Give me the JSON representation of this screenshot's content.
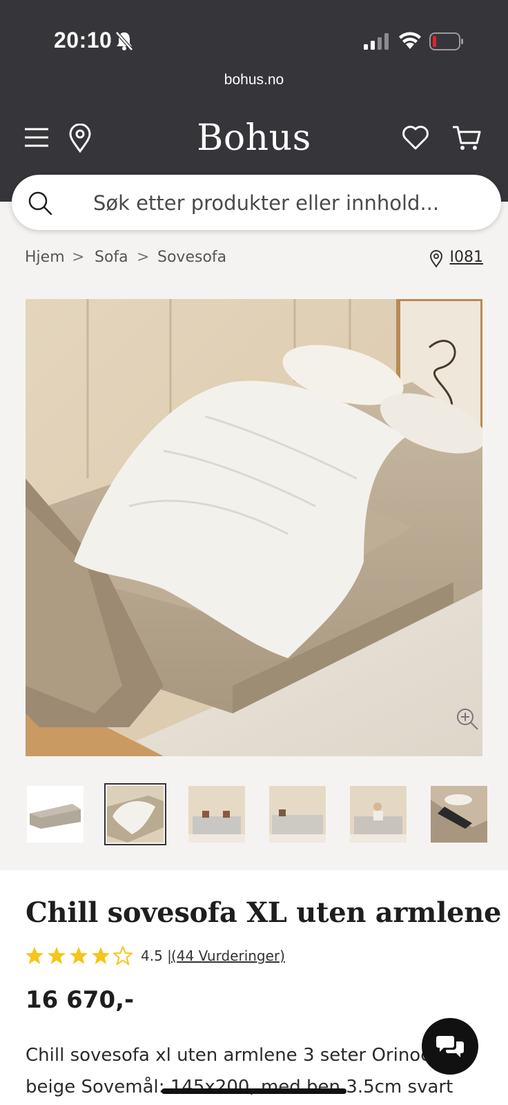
{
  "status_bar": {
    "time": "20:10"
  },
  "browser": {
    "url": "bohus.no"
  },
  "header": {
    "logo": "Bohus"
  },
  "search": {
    "placeholder": "Søk etter produkter eller innhold..."
  },
  "breadcrumb": {
    "items": [
      "Hjem",
      "Sofa",
      "Sovesofa"
    ],
    "separator": ">"
  },
  "store": {
    "label": "I081"
  },
  "gallery": {
    "thumbnail_count": 6,
    "selected_index": 1
  },
  "product": {
    "title": "Chill sovesofa XL uten armlene",
    "rating": "4.5",
    "rating_sep": "|",
    "rating_fraction": 0.9,
    "reviews": "(44 Vurderinger)",
    "price": "16 670,-",
    "description": "Chill sovesofa xl uten armlene 3 seter Orinoco beige Sovemål: 145x200, med ben 3.5cm svart"
  },
  "colors": {
    "header_bg": "#35353a",
    "star": "#f5c518",
    "page_bg": "#f5f3f1"
  }
}
